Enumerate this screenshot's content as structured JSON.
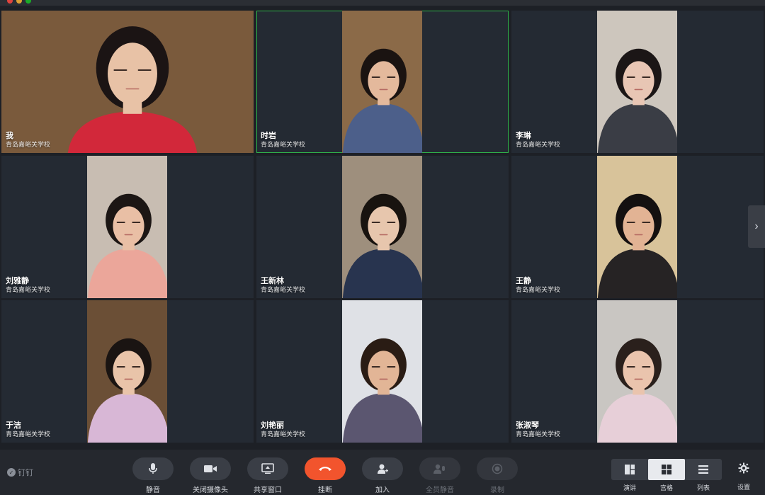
{
  "participants": [
    {
      "name": "我",
      "org": "青岛嘉峪关学校",
      "bg": "#7a5a3c",
      "skin": "#e8c2a6",
      "hair": "#1b1414",
      "shirt": "#d2283a",
      "video": "full",
      "active": false
    },
    {
      "name": "时岩",
      "org": "青岛嘉峪关学校",
      "bg": "#8b6a48",
      "skin": "#e4b99c",
      "hair": "#1a1311",
      "shirt": "#4c5f8a",
      "video": "center",
      "active": true
    },
    {
      "name": "李琳",
      "org": "青岛嘉峪关学校",
      "bg": "#cdc6bd",
      "skin": "#e8c6b4",
      "hair": "#1b1616",
      "shirt": "#3a3d45",
      "video": "center",
      "active": false
    },
    {
      "name": "刘雅静",
      "org": "青岛嘉峪关学校",
      "bg": "#c8bdb2",
      "skin": "#e9bfa5",
      "hair": "#1c1614",
      "shirt": "#eba69a",
      "video": "center",
      "active": false
    },
    {
      "name": "王新林",
      "org": "青岛嘉峪关学校",
      "bg": "#9e8f7d",
      "skin": "#e7c6ad",
      "hair": "#18130f",
      "shirt": "#28344f",
      "video": "center",
      "active": false
    },
    {
      "name": "王静",
      "org": "青岛嘉峪关学校",
      "bg": "#d8c39a",
      "skin": "#e2b394",
      "hair": "#141010",
      "shirt": "#262324",
      "video": "center",
      "active": false
    },
    {
      "name": "于洁",
      "org": "青岛嘉峪关学校",
      "bg": "#6b4f36",
      "skin": "#e9c4a9",
      "hair": "#1a1412",
      "shirt": "#d8b7d6",
      "video": "center",
      "active": false
    },
    {
      "name": "刘艳丽",
      "org": "青岛嘉峪关学校",
      "bg": "#dfe1e6",
      "skin": "#e2b596",
      "hair": "#2a1c14",
      "shirt": "#5b5670",
      "video": "center",
      "active": false
    },
    {
      "name": "张淑琴",
      "org": "青岛嘉峪关学校",
      "bg": "#c9c6c2",
      "skin": "#eac4ad",
      "hair": "#2a201c",
      "shirt": "#e7cfd8",
      "video": "center",
      "active": false
    }
  ],
  "toolbar": {
    "brand": "钉钉",
    "buttons": [
      {
        "label": "静音",
        "icon": "microphone-icon",
        "state": "normal"
      },
      {
        "label": "关闭摄像头",
        "icon": "camera-icon",
        "state": "normal"
      },
      {
        "label": "共享窗口",
        "icon": "share-screen-icon",
        "state": "normal"
      },
      {
        "label": "挂断",
        "icon": "hang-up-icon",
        "state": "danger"
      },
      {
        "label": "加入",
        "icon": "add-person-icon",
        "state": "normal"
      },
      {
        "label": "全员静音",
        "icon": "mute-all-icon",
        "state": "disabled"
      },
      {
        "label": "录制",
        "icon": "record-icon",
        "state": "disabled"
      }
    ],
    "views": [
      {
        "label": "演讲",
        "icon": "speaker-view-icon",
        "selected": false
      },
      {
        "label": "宫格",
        "icon": "grid-view-icon",
        "selected": true
      },
      {
        "label": "列表",
        "icon": "list-view-icon",
        "selected": false
      }
    ],
    "settings_label": "设置"
  },
  "colors": {
    "active_border": "#2fb44a",
    "hangup": "#f2542d",
    "tile_bg": "#242a33"
  }
}
